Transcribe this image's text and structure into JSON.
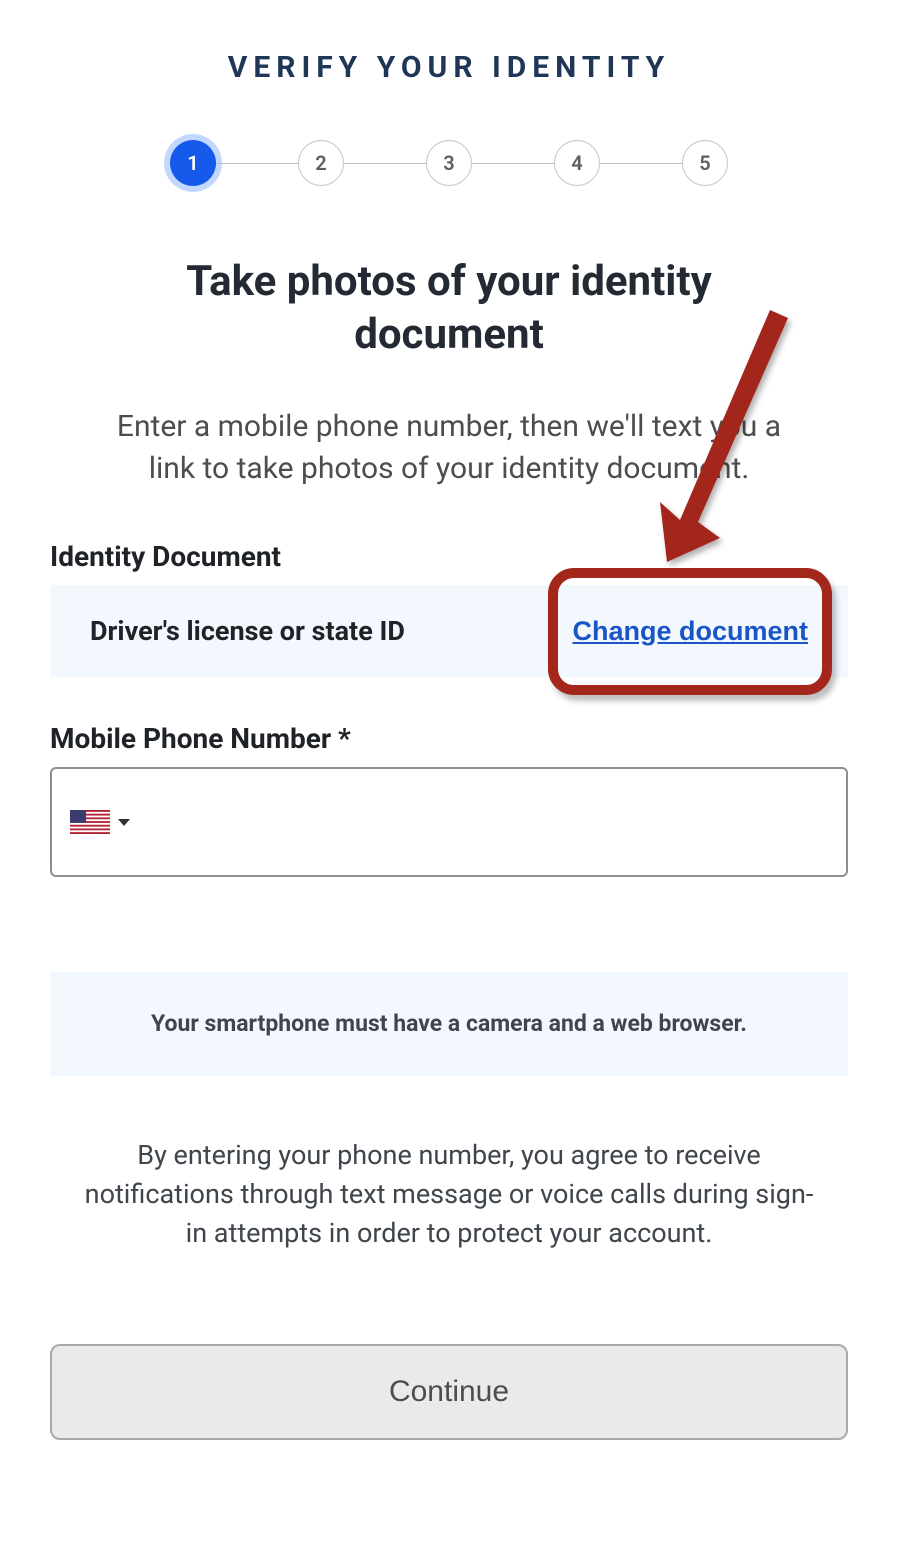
{
  "header": {
    "title": "VERIFY YOUR IDENTITY"
  },
  "stepper": {
    "current": 1,
    "steps": [
      "1",
      "2",
      "3",
      "4",
      "5"
    ]
  },
  "main": {
    "heading": "Take photos of your identity document",
    "description": "Enter a mobile phone number, then we'll text you a link to take photos of your identity document."
  },
  "identity_doc": {
    "label": "Identity Document",
    "value": "Driver's license or state ID",
    "change_label": "Change document"
  },
  "phone": {
    "label": "Mobile Phone Number *",
    "country_name": "US",
    "value": "",
    "placeholder": ""
  },
  "info": {
    "text": "Your smartphone must have a camera and a web browser."
  },
  "consent": {
    "text": "By entering your phone number, you agree to receive notifications through text message or voice calls during sign-in attempts in order to protect your account."
  },
  "actions": {
    "continue_label": "Continue"
  }
}
